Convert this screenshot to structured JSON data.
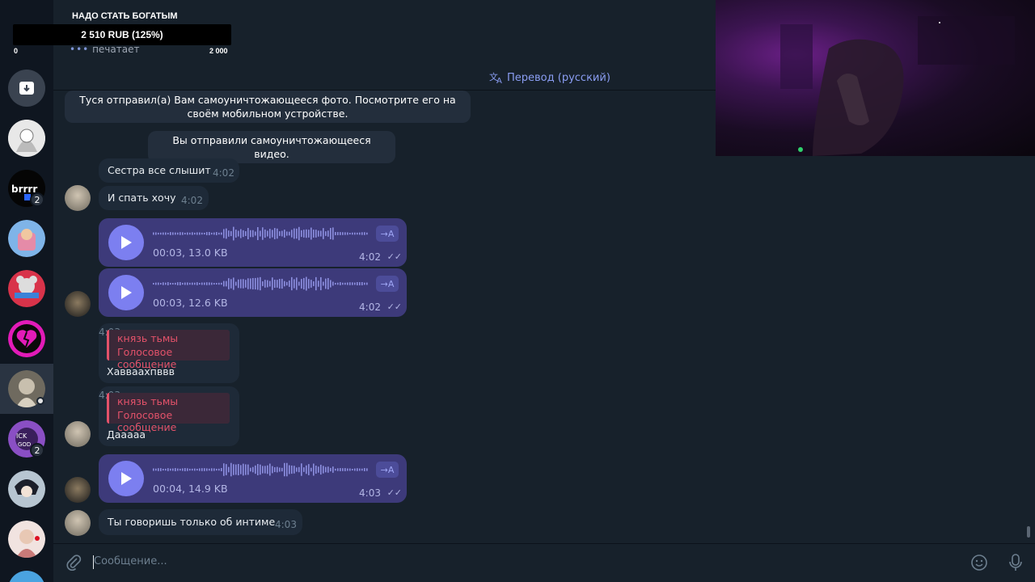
{
  "overlay": {
    "goal_title": "НАДО СТАТЬ БОГАТЫМ",
    "goal_amount": "2 510 RUB (125%)",
    "goal_min": "0",
    "goal_max": "2 000",
    "goal_progress_percent": 125
  },
  "header": {
    "status": "печатает",
    "translate_label": "Перевод (русский)"
  },
  "sidebar": {
    "items": [
      {
        "name": "archive"
      },
      {
        "name": "chat-1"
      },
      {
        "name": "chat-2",
        "badge": "2"
      },
      {
        "name": "chat-3"
      },
      {
        "name": "chat-4"
      },
      {
        "name": "chat-5"
      },
      {
        "name": "chat-6-active"
      },
      {
        "name": "chat-7",
        "badge": "2"
      },
      {
        "name": "chat-8"
      },
      {
        "name": "chat-9"
      }
    ]
  },
  "messages": {
    "service1": "Туся отправил(а) Вам самоуничтожающееся фото. Посмотрите его на своём мобильном устройстве.",
    "service2": "Вы отправили самоуничтожающееся видео.",
    "m1": {
      "text": "Сестра все слышит",
      "time": "4:02"
    },
    "m2": {
      "text": "И спать хочу",
      "time": "4:02"
    },
    "v1": {
      "meta": "00:03, 13.0 KB",
      "time": "4:02",
      "tr": "→A"
    },
    "v2": {
      "meta": "00:03, 12.6 KB",
      "time": "4:02",
      "tr": "→A"
    },
    "r1": {
      "name": "князь тьмы",
      "sub": "Голосовое сообщение",
      "text": "Хавваахпввв",
      "time": "4:03"
    },
    "r2": {
      "name": "князь тьмы",
      "sub": "Голосовое сообщение",
      "text": "Дааааа",
      "time": "4:03"
    },
    "v3": {
      "meta": "00:04, 14.9 KB",
      "time": "4:03",
      "tr": "→A"
    },
    "m3": {
      "text": "Ты говоришь только об интиме",
      "time": "4:03"
    }
  },
  "composer": {
    "placeholder": "Сообщение..."
  },
  "colors": {
    "accent": "#7c7ff0",
    "voice_bubble": "#3d3a7a",
    "reply_red": "#e4526a"
  }
}
